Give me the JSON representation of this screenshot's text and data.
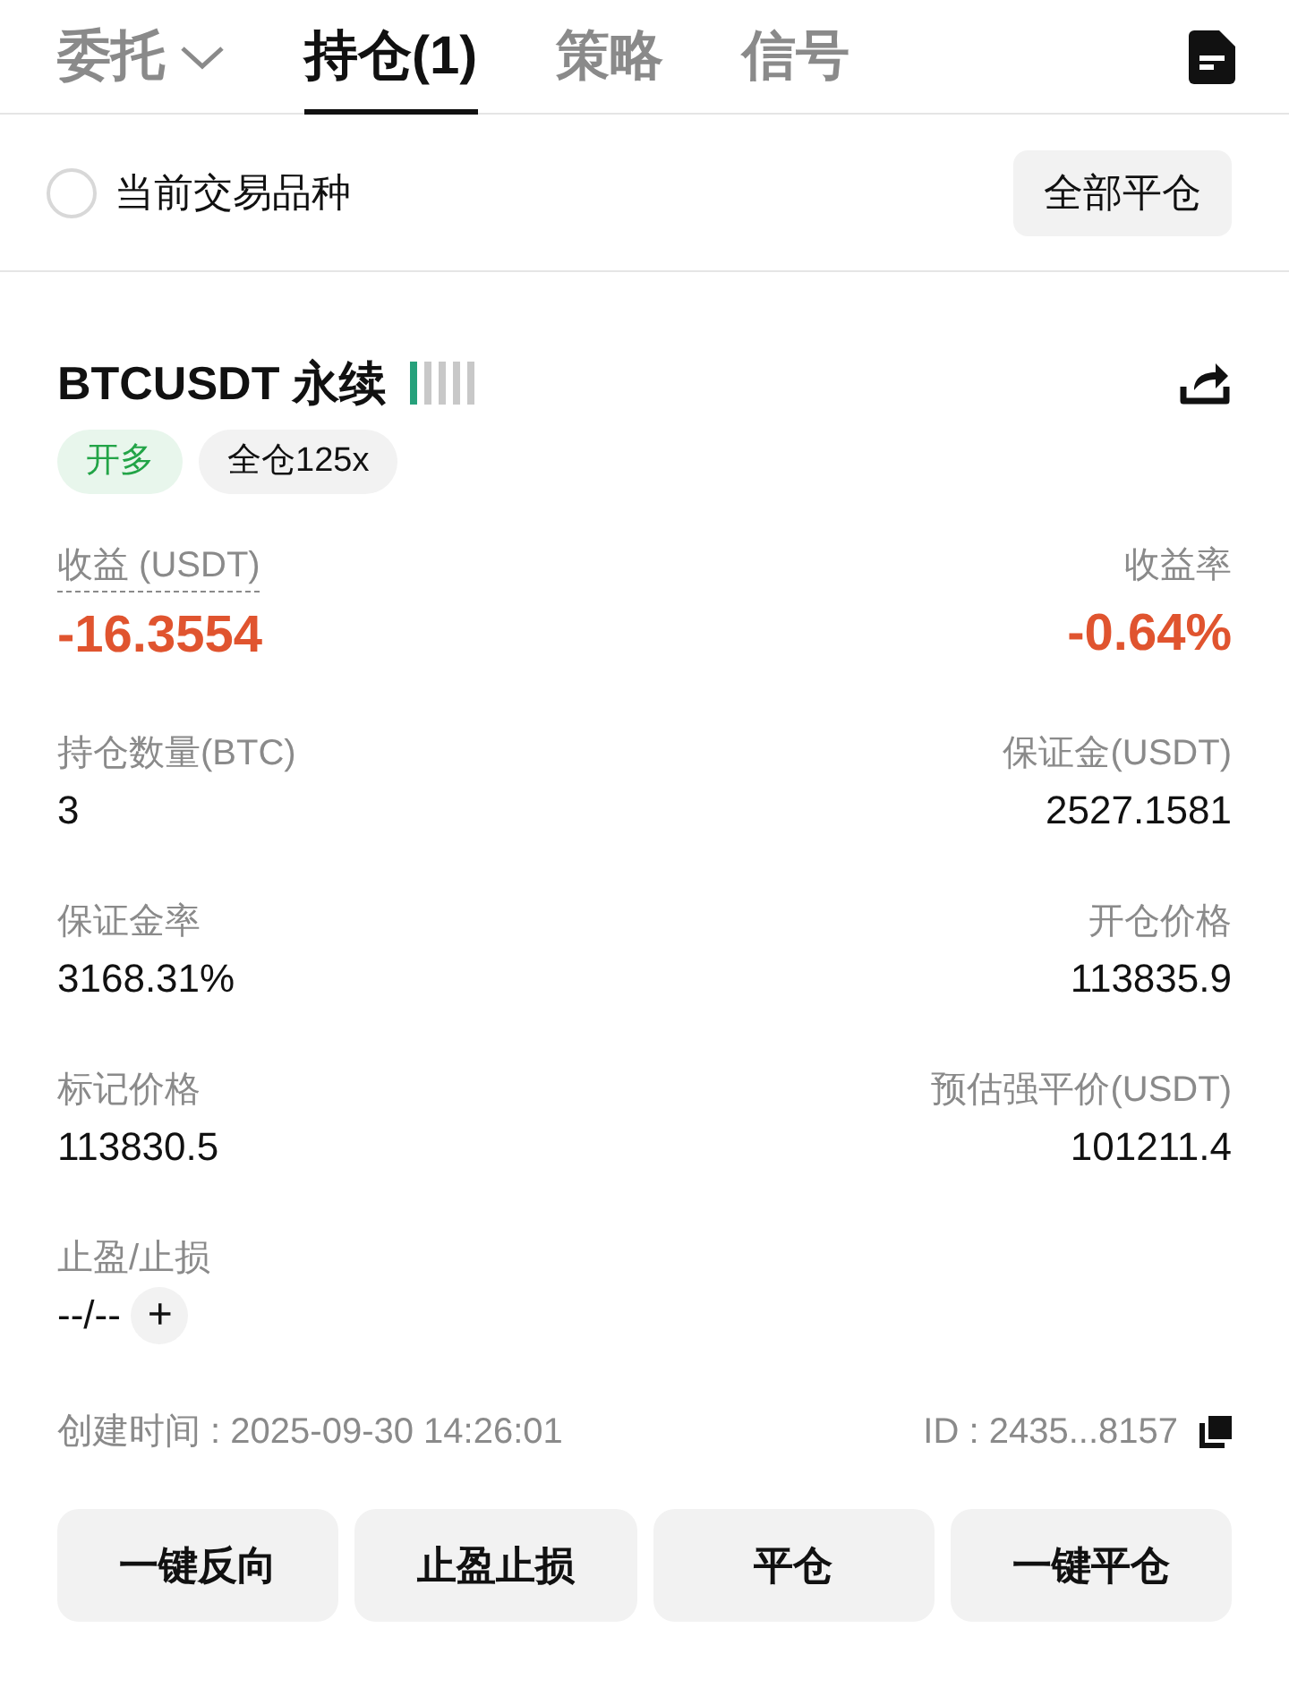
{
  "tabs": [
    {
      "label": "委托",
      "selected": false,
      "dropdown": true
    },
    {
      "label": "持仓(1)",
      "selected": true,
      "dropdown": false
    },
    {
      "label": "策略",
      "selected": false,
      "dropdown": false
    },
    {
      "label": "信号",
      "selected": false,
      "dropdown": false
    }
  ],
  "filter": {
    "label": "当前交易品种",
    "checked": false,
    "button": "全部平仓"
  },
  "position": {
    "symbol": "BTCUSDT 永续",
    "risk": [
      {
        "lit": true
      },
      {
        "lit": false
      },
      {
        "lit": false
      },
      {
        "lit": false
      },
      {
        "lit": false
      }
    ],
    "tags": [
      {
        "label": "开多",
        "kind": "side"
      },
      {
        "label": "全仓125x",
        "kind": "mode"
      }
    ],
    "rows": [
      {
        "kind": "pnl",
        "left": {
          "label": "收益 (USDT)",
          "value": "-16.3554"
        },
        "right": {
          "label": "收益率",
          "value": "-0.64%"
        }
      },
      {
        "kind": "plain",
        "left": {
          "label": "持仓数量(BTC)",
          "value": "3"
        },
        "right": {
          "label": "保证金(USDT)",
          "value": "2527.1581"
        }
      },
      {
        "kind": "plain",
        "left": {
          "label": "保证金率",
          "value": "3168.31%"
        },
        "right": {
          "label": "开仓价格",
          "value": "113835.9"
        }
      },
      {
        "kind": "plain",
        "left": {
          "label": "标记价格",
          "value": "113830.5"
        },
        "right": {
          "label": "预估强平价(USDT)",
          "value": "101211.4"
        }
      }
    ],
    "tpsl": {
      "label": "止盈/止损",
      "value": "--/--",
      "add": "+"
    },
    "created": "创建时间 : 2025-09-30 14:26:01",
    "id": "ID : 2435...8157",
    "actions": [
      "一键反向",
      "止盈止损",
      "平仓",
      "一键平仓"
    ]
  }
}
